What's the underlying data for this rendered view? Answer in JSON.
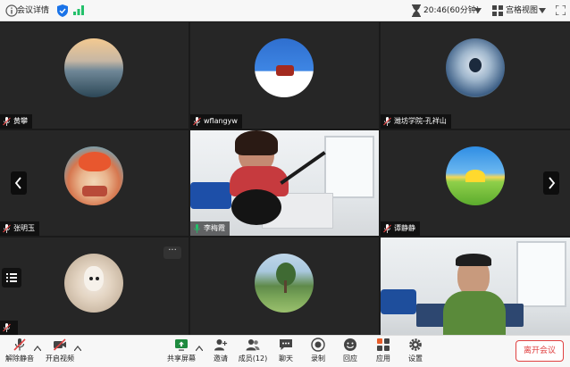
{
  "topbar": {
    "title": "会议详情",
    "time": "20:46(60分钟)",
    "view_label": "宫格视图"
  },
  "participants": [
    {
      "name": "黄攀"
    },
    {
      "name": "wflangyw"
    },
    {
      "name": "潍坊学院-孔祥山"
    },
    {
      "name": "张明玉"
    },
    {
      "name": "李梅霞"
    },
    {
      "name": "谭静静"
    },
    {
      "name": ""
    },
    {
      "name": ""
    },
    {
      "name": ""
    }
  ],
  "toolbar": {
    "unmute": "解除静音",
    "start_video": "开启视频",
    "share_screen": "共享屏幕",
    "invite": "邀请",
    "members": "成员(12)",
    "chat": "聊天",
    "record": "录制",
    "reactions": "回应",
    "apps": "应用",
    "settings": "设置",
    "leave": "离开会议"
  },
  "more_label": "···",
  "colors": {
    "accent": "#23c06a",
    "leave": "#e04141",
    "mic_muted": "#e04141",
    "mic_active": "#23c06a"
  }
}
